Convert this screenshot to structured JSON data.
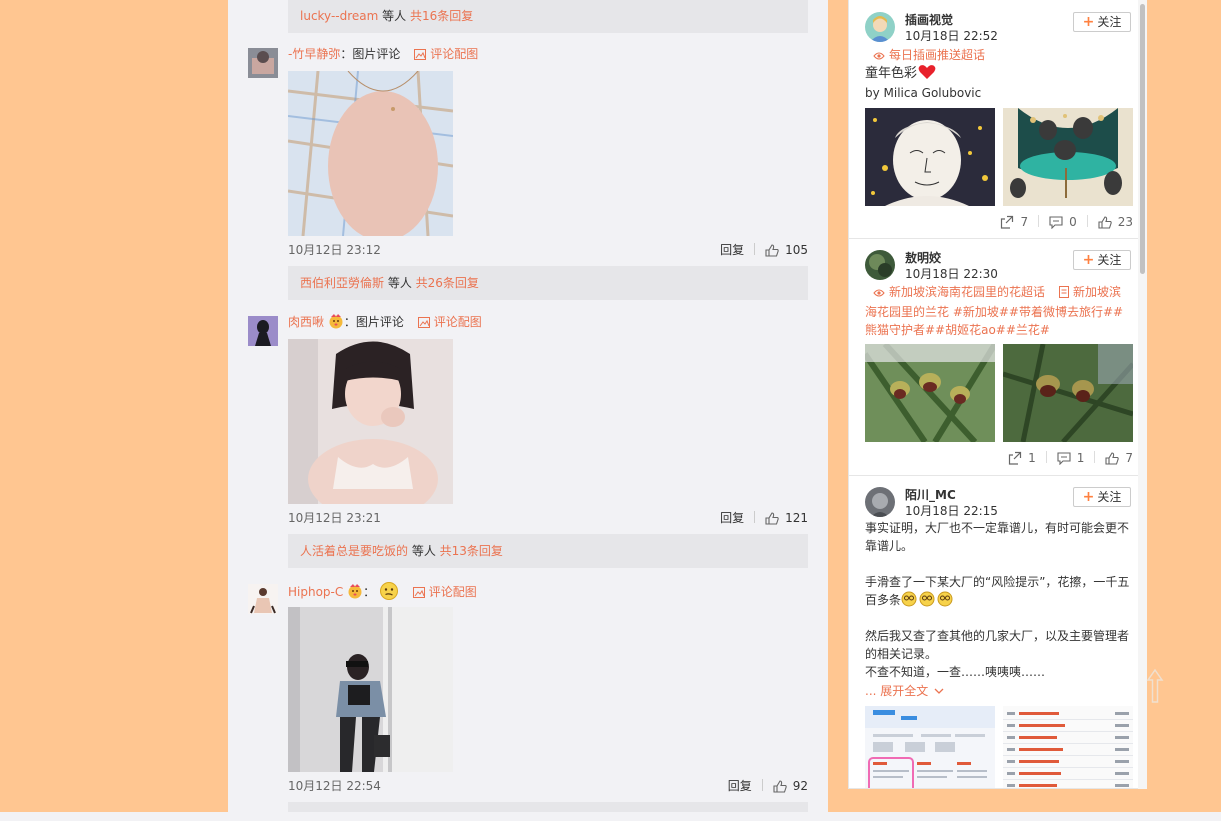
{
  "comments": {
    "summaries": [
      {
        "who": "lucky--dream",
        "mid": " 等人 ",
        "count": "共16条回复"
      },
      {
        "who": "西伯利亞勞倫斯",
        "mid": " 等人 ",
        "count": "共26条回复"
      },
      {
        "who": "人活着总是要吃饭的",
        "mid": " 等人 ",
        "count": "共13条回复"
      }
    ],
    "items": [
      {
        "name": "-竹早静弥",
        "sep": "：图片评论",
        "pic_label": "评论配图",
        "time": "10月12日 23:12",
        "reply": "回复",
        "likes": "105"
      },
      {
        "name": "肉西啾",
        "sep": "：图片评论",
        "pic_label": "评论配图",
        "time": "10月12日 23:21",
        "reply": "回复",
        "likes": "121"
      },
      {
        "name": "Hiphop-C",
        "sep": "：",
        "pic_label": "评论配图",
        "time": "10月12日 22:54",
        "reply": "回复",
        "likes": "92"
      }
    ]
  },
  "feed": {
    "follow_label": "关注",
    "cards": [
      {
        "user": "插画视觉",
        "time": "10月18日 22:52",
        "topic": "每日插画推送超话",
        "text1": "童年色彩",
        "text2": "by Milica Golubovic",
        "reposts": "7",
        "comments": "0",
        "likes": "23"
      },
      {
        "user": "敖明姣",
        "time": "10月18日 22:30",
        "topic": "新加坡滨海南花园里的花超话",
        "topic2": "新加坡滨",
        "topic_rest": "海花园里的兰花 #新加坡##带着微博去旅行##熊猫守护者##胡姬花ao##兰花#",
        "reposts": "1",
        "comments": "1",
        "likes": "7"
      },
      {
        "user": "陌川_MC",
        "time": "10月18日 22:15",
        "p1": "事实证明，大厂也不一定靠谱儿，有时可能会更不靠谱儿。",
        "p2": "手滑查了一下某大厂的“风险提示”，花擦，一千五百多条",
        "p3": "然后我又查了查其他的几家大厂，以及主要管理者的相关记录。",
        "p4": "不查不知道，一查……咦咦咦……",
        "expand_prefix": "... ",
        "expand": "展开全文"
      }
    ]
  },
  "colors": {
    "accent": "#eb7350",
    "page_bg": "#ffc691",
    "follow_plus": "#ff8140"
  }
}
